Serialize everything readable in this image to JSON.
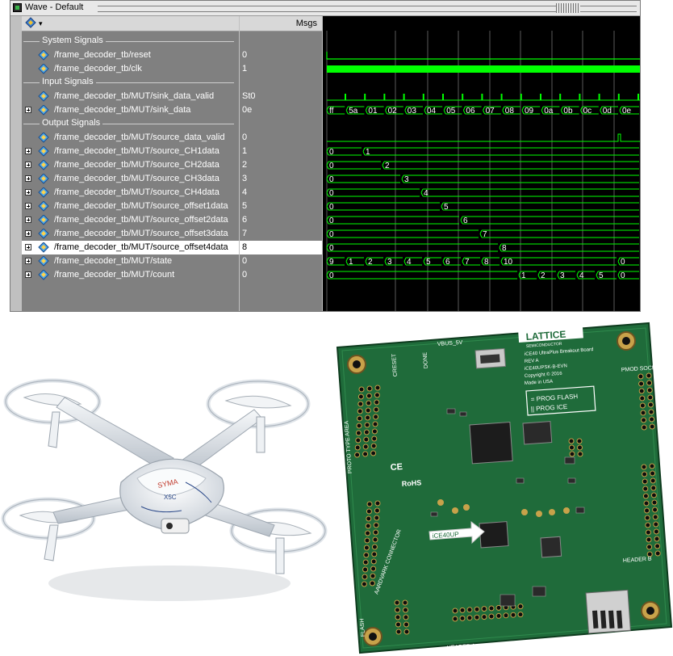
{
  "window": {
    "title": "Wave - Default"
  },
  "header": {
    "msgs_label": "Msgs"
  },
  "groups": {
    "system": "System Signals",
    "input": "Input Signals",
    "output": "Output Signals"
  },
  "signals": [
    {
      "name": "/frame_decoder_tb/reset",
      "value": "0"
    },
    {
      "name": "/frame_decoder_tb/clk",
      "value": "1"
    },
    {
      "name": "/frame_decoder_tb/MUT/sink_data_valid",
      "value": "St0"
    },
    {
      "name": "/frame_decoder_tb/MUT/sink_data",
      "value": "0e"
    },
    {
      "name": "/frame_decoder_tb/MUT/source_data_valid",
      "value": "0"
    },
    {
      "name": "/frame_decoder_tb/MUT/source_CH1data",
      "value": "1"
    },
    {
      "name": "/frame_decoder_tb/MUT/source_CH2data",
      "value": "2"
    },
    {
      "name": "/frame_decoder_tb/MUT/source_CH3data",
      "value": "3"
    },
    {
      "name": "/frame_decoder_tb/MUT/source_CH4data",
      "value": "4"
    },
    {
      "name": "/frame_decoder_tb/MUT/source_offset1data",
      "value": "5"
    },
    {
      "name": "/frame_decoder_tb/MUT/source_offset2data",
      "value": "6"
    },
    {
      "name": "/frame_decoder_tb/MUT/source_offset3data",
      "value": "7"
    },
    {
      "name": "/frame_decoder_tb/MUT/source_offset4data",
      "value": "8"
    },
    {
      "name": "/frame_decoder_tb/MUT/state",
      "value": "0"
    },
    {
      "name": "/frame_decoder_tb/MUT/count",
      "value": "0"
    }
  ],
  "waves": {
    "sink_data": [
      "ff",
      "5a",
      "01",
      "02",
      "03",
      "04",
      "05",
      "06",
      "07",
      "08",
      "09",
      "0a",
      "0b",
      "0c",
      "0d",
      "0e"
    ],
    "ch_initial": "0",
    "ch_values": [
      "1",
      "2",
      "3",
      "4",
      "5",
      "6",
      "7",
      "8"
    ],
    "state": [
      "9",
      "1",
      "2",
      "3",
      "4",
      "5",
      "6",
      "7",
      "8",
      "10",
      "0"
    ],
    "count": [
      "0",
      "1",
      "2",
      "3",
      "4",
      "5",
      "0"
    ]
  },
  "pcb_text": {
    "brand": "LATTICE",
    "brand_sub": "SEMICONDUCTOR",
    "board_title": "iCE40 UltraPlus Breakout Board",
    "rev": "REV A",
    "part": "iCE40UPSK-B-EVN",
    "copyright": "Copyright © 2016",
    "made_in": "Made in USA",
    "prog_flash": "= PROG FLASH",
    "prog_ice": "|| PROG ICE",
    "chip_arrow": "iCE40UP",
    "rohs": "RoHS",
    "ce": "CE",
    "pmod": "PMOD SOCKET",
    "header_a": "HEADER A",
    "header_b": "HEADER B",
    "header_c": "HEADER C",
    "proto": "PROTO TYPE AREA",
    "flash": "FLASH",
    "aardvark": "AARDVARK CONNECTOR",
    "done": "DONE",
    "vbus": "VBUS_5V",
    "creset": "CRESET"
  },
  "colors": {
    "wave_green": "#00ff00",
    "pcb_green": "#1f6b3a",
    "grid": "#5a5a5a",
    "names_bg": "#808080"
  }
}
